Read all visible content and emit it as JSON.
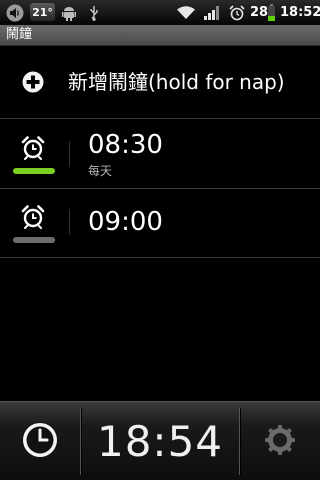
{
  "status_bar": {
    "temperature": "21°",
    "battery_level": "28",
    "time": "18:52",
    "icons": [
      "volume-icon",
      "android-icon",
      "usb-icon",
      "wifi-icon",
      "signal-icon",
      "alarm-icon",
      "battery-icon"
    ]
  },
  "title_bar": {
    "title": "鬧鐘"
  },
  "add_alarm": {
    "label": "新增鬧鐘(hold for nap)",
    "icon": "plus-circle-icon"
  },
  "alarms": [
    {
      "time": "08:30",
      "repeat": "每天",
      "enabled": true,
      "indicator_color": "#7ccf1f"
    },
    {
      "time": "09:00",
      "repeat": "",
      "enabled": false,
      "indicator_color": "#6e6e6e"
    }
  ],
  "bottom_bar": {
    "clock": "18:54",
    "left_icon": "clock-icon",
    "right_icon": "settings-icon"
  }
}
